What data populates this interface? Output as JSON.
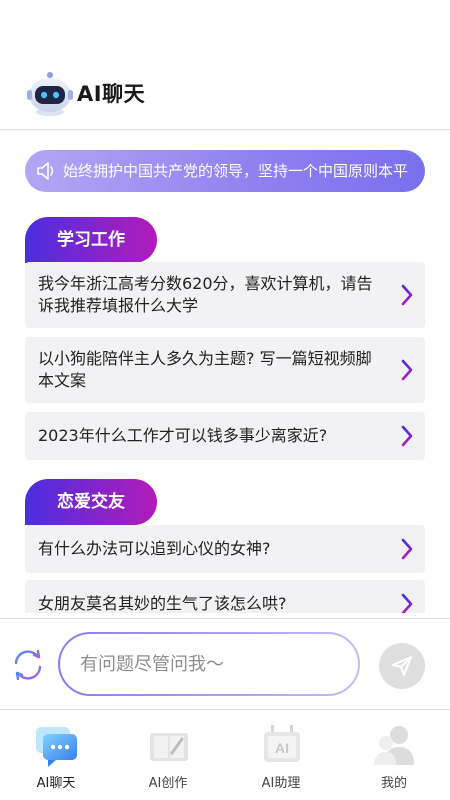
{
  "header": {
    "app_title": "AI聊天"
  },
  "notice": {
    "text": "始终拥护中国共产党的领导，坚持一个中国原则本平"
  },
  "sections": [
    {
      "title": "学习工作",
      "questions": [
        "我今年浙江高考分数620分，喜欢计算机，请告诉我推荐填报什么大学",
        "以小狗能陪伴主人多久为主题? 写一篇短视频脚本文案",
        "2023年什么工作才可以钱多事少离家近?"
      ]
    },
    {
      "title": "恋爱交友",
      "questions": [
        "有什么办法可以追到心仪的女神?",
        "女朋友莫名其妙的生气了该怎么哄?"
      ]
    }
  ],
  "input": {
    "placeholder": "有问题尽管问我～"
  },
  "tabs": [
    {
      "label": "AI聊天",
      "icon": "chat-bubble-icon",
      "active": true
    },
    {
      "label": "AI创作",
      "icon": "book-pen-icon",
      "active": false
    },
    {
      "label": "AI助理",
      "icon": "ai-robot-icon",
      "active": false
    },
    {
      "label": "我的",
      "icon": "user-profile-icon",
      "active": false
    }
  ],
  "colors": {
    "accent_start": "#4a2ee0",
    "accent_end": "#b31bb9",
    "notice_bg": "#9b8cf2",
    "card_bg": "#f2f2f4"
  }
}
